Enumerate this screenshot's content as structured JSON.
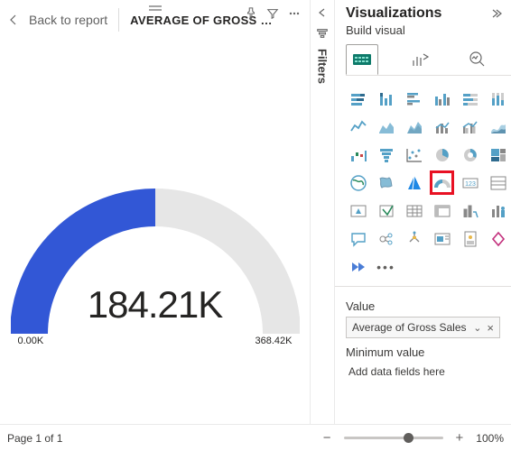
{
  "header": {
    "back_label": "Back to report",
    "title": "AVERAGE OF GROSS SAL…"
  },
  "chart_data": {
    "type": "gauge",
    "value": 184.21,
    "min": 0.0,
    "max": 368.42,
    "unit_suffix": "K",
    "value_display": "184.21K",
    "min_display": "0.00K",
    "max_display": "368.42K",
    "fill_fraction": 0.5,
    "fill_color": "#3257d6",
    "track_color": "#e6e6e6"
  },
  "footer": {
    "page_label": "Page 1 of 1",
    "zoom_display": "100%",
    "zoom_fraction": 0.6
  },
  "filters": {
    "label": "Filters"
  },
  "viz": {
    "title": "Visualizations",
    "subtitle": "Build visual",
    "modes": [
      {
        "id": "build",
        "name": "build-visual-mode",
        "selected": true
      },
      {
        "id": "format",
        "name": "format-visual-mode",
        "selected": false
      },
      {
        "id": "analytics",
        "name": "analytics-mode",
        "selected": false
      }
    ],
    "types": [
      "stacked-bar-chart",
      "stacked-column-chart",
      "clustered-bar-chart",
      "clustered-column-chart",
      "hundred-percent-stacked-bar-chart",
      "hundred-percent-stacked-column-chart",
      "line-chart",
      "area-chart",
      "stacked-area-chart",
      "line-stacked-column-chart",
      "line-clustered-column-chart",
      "ribbon-chart",
      "waterfall-chart",
      "funnel-chart",
      "scatter-chart",
      "pie-chart",
      "donut-chart",
      "treemap",
      "map",
      "filled-map",
      "azure-map",
      "gauge",
      "card",
      "multi-row-card",
      "kpi",
      "slicer",
      "table",
      "matrix",
      "r-visual",
      "python-visual",
      "qa",
      "key-influencers",
      "decomposition-tree",
      "smart-narrative",
      "paginated-report",
      "power-apps",
      "power-automate",
      "more-visuals"
    ],
    "highlighted": "gauge"
  },
  "fields": {
    "value_label": "Value",
    "value_item": "Average of Gross Sales",
    "min_label": "Minimum value",
    "min_placeholder": "Add data fields here"
  }
}
